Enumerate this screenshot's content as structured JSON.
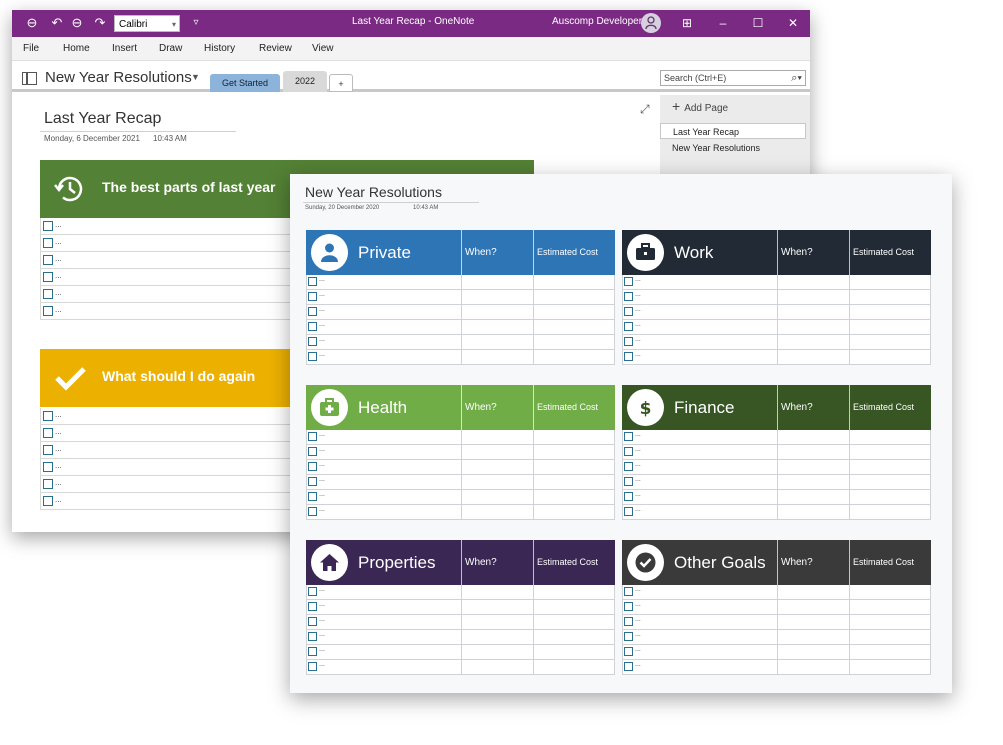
{
  "window": {
    "title": "Last Year Recap - OneNote",
    "user": "Auscomp Developer",
    "font_name": "Calibri",
    "accent_color": "#7a2a82"
  },
  "menu": [
    "File",
    "Home",
    "Insert",
    "Draw",
    "History",
    "Review",
    "View"
  ],
  "notebook": {
    "name": "New Year Resolutions",
    "tabs": [
      {
        "label": "Get Started",
        "color": "#8cb3d9"
      },
      {
        "label": "2022",
        "color": "#d9d9d9"
      },
      {
        "label": "+",
        "color": "#ffffff"
      }
    ],
    "search_placeholder": "Search (Ctrl+E)"
  },
  "pages_panel": {
    "add_label": "Add Page",
    "pages": [
      "Last Year Recap",
      "New Year Resolutions"
    ]
  },
  "recap_page": {
    "title": "Last Year Recap",
    "date": "Monday, 6 December 2021",
    "time": "10:43 AM",
    "sections": [
      {
        "title": "The best parts of last year",
        "color": "#538135",
        "icon": "history-icon",
        "rows": [
          "...",
          "...",
          "...",
          "...",
          "...",
          "..."
        ]
      },
      {
        "title": "What should I do again",
        "color": "#ecb100",
        "icon": "checkmark-icon",
        "rows": [
          "...",
          "...",
          "...",
          "...",
          "...",
          "..."
        ]
      }
    ]
  },
  "resolutions_page": {
    "title": "New Year Resolutions",
    "date": "Sunday, 20 December 2020",
    "time": "10:43 AM",
    "categories": [
      {
        "name": "Private",
        "when": "When?",
        "cost": "Estimated Cost",
        "color": "#2e75b6",
        "icon": "person-icon",
        "rows": [
          "...",
          "...",
          "...",
          "...",
          "...",
          "..."
        ]
      },
      {
        "name": "Work",
        "when": "When?",
        "cost": "Estimated Cost",
        "color": "#222a35",
        "icon": "briefcase-icon",
        "rows": [
          "...",
          "...",
          "...",
          "...",
          "...",
          "..."
        ]
      },
      {
        "name": "Health",
        "when": "When?",
        "cost": "Estimated Cost",
        "color": "#70ad47",
        "icon": "first-aid-icon",
        "rows": [
          "...",
          "...",
          "...",
          "...",
          "...",
          "..."
        ]
      },
      {
        "name": "Finance",
        "when": "When?",
        "cost": "Estimated Cost",
        "color": "#375623",
        "icon": "dollar-icon",
        "rows": [
          "...",
          "...",
          "...",
          "...",
          "...",
          "..."
        ]
      },
      {
        "name": "Properties",
        "when": "When?",
        "cost": "Estimated Cost",
        "color": "#3b2753",
        "icon": "house-icon",
        "rows": [
          "...",
          "...",
          "...",
          "...",
          "...",
          "..."
        ]
      },
      {
        "name": "Other Goals",
        "when": "When?",
        "cost": "Estimated Cost",
        "color": "#3a3a3a",
        "icon": "checkmark-icon",
        "rows": [
          "...",
          "...",
          "...",
          "...",
          "...",
          "..."
        ]
      }
    ]
  }
}
